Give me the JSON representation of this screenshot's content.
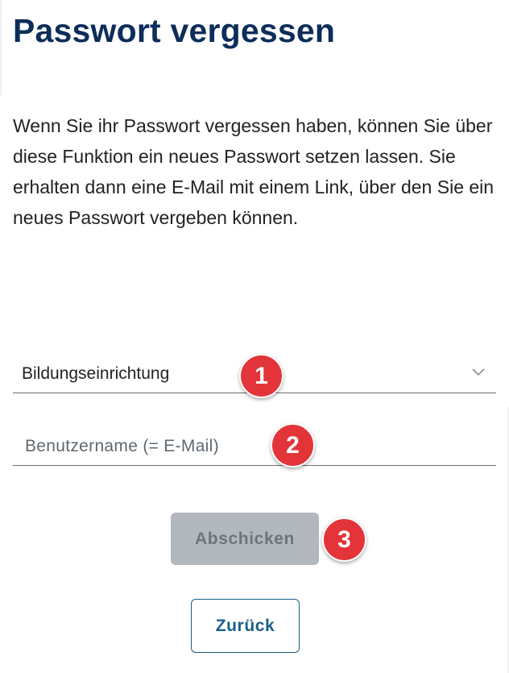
{
  "page": {
    "title": "Passwort vergessen",
    "description": "Wenn Sie ihr Passwort vergessen haben, können Sie über diese Funktion ein neues Passwort setzen lassen. Sie erhalten dann eine E-Mail mit einem Link, über den Sie ein neues Passwort vergeben können."
  },
  "form": {
    "institution_select": {
      "selected": "Bildungseinrichtung",
      "icon": "chevron-down-icon"
    },
    "username_input": {
      "value": "",
      "placeholder": "Benutzername (= E-Mail)"
    },
    "submit_label": "Abschicken",
    "submit_disabled": true,
    "back_label": "Zurück"
  },
  "annotations": {
    "markers": [
      "1",
      "2",
      "3"
    ],
    "color": "#e3343a"
  },
  "colors": {
    "title": "#0d2d5a",
    "text": "#222222",
    "submit_disabled_bg": "#b2b8bd",
    "back_accent": "#1a5f87"
  }
}
